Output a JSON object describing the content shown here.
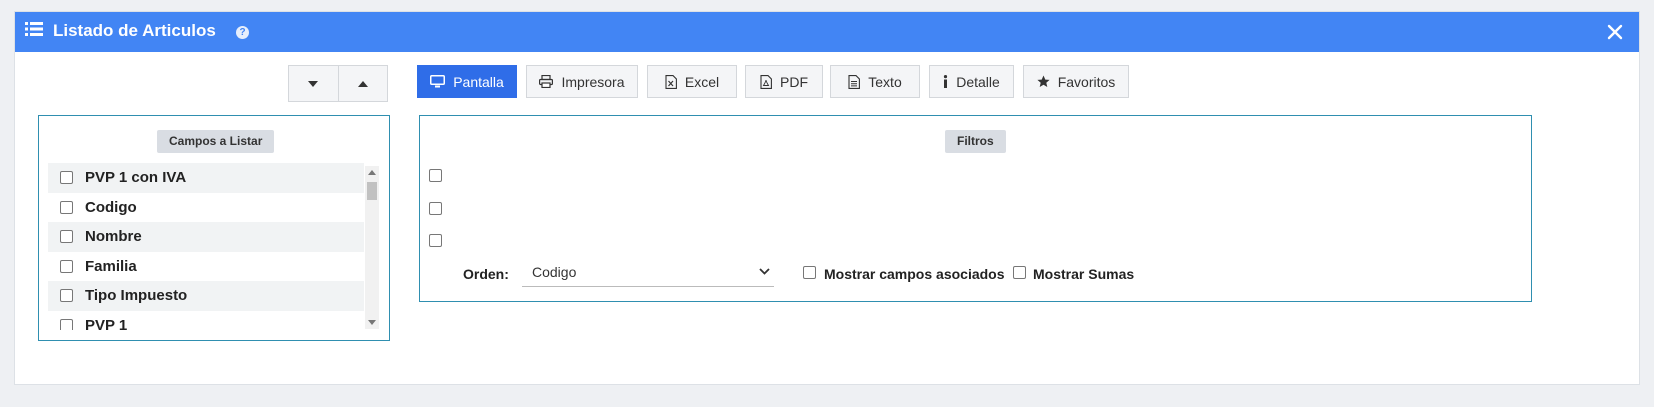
{
  "window": {
    "title": "Listado de Articulos",
    "help_glyph": "?",
    "accent_color": "#4285f4"
  },
  "sort_buttons": [
    {
      "icon": "caret-down-icon"
    },
    {
      "icon": "caret-up-icon"
    }
  ],
  "toolbar": {
    "pantalla": "Pantalla",
    "impresora": "Impresora",
    "excel": "Excel",
    "pdf": "PDF",
    "texto": "Texto",
    "detalle": "Detalle",
    "favoritos": "Favoritos",
    "primary_color": "#2f6de8"
  },
  "campos": {
    "header": "Campos a Listar",
    "items": [
      {
        "label": "PVP 1 con IVA",
        "checked": false
      },
      {
        "label": "Codigo",
        "checked": false
      },
      {
        "label": "Nombre",
        "checked": false
      },
      {
        "label": "Familia",
        "checked": false
      },
      {
        "label": "Tipo Impuesto",
        "checked": false
      },
      {
        "label": "PVP 1",
        "checked": false
      }
    ]
  },
  "filtros": {
    "header": "Filtros",
    "orden_label": "Orden:",
    "orden_value": "Codigo",
    "mostrar_campos": "Mostrar campos asociados",
    "mostrar_sumas": "Mostrar Sumas"
  }
}
